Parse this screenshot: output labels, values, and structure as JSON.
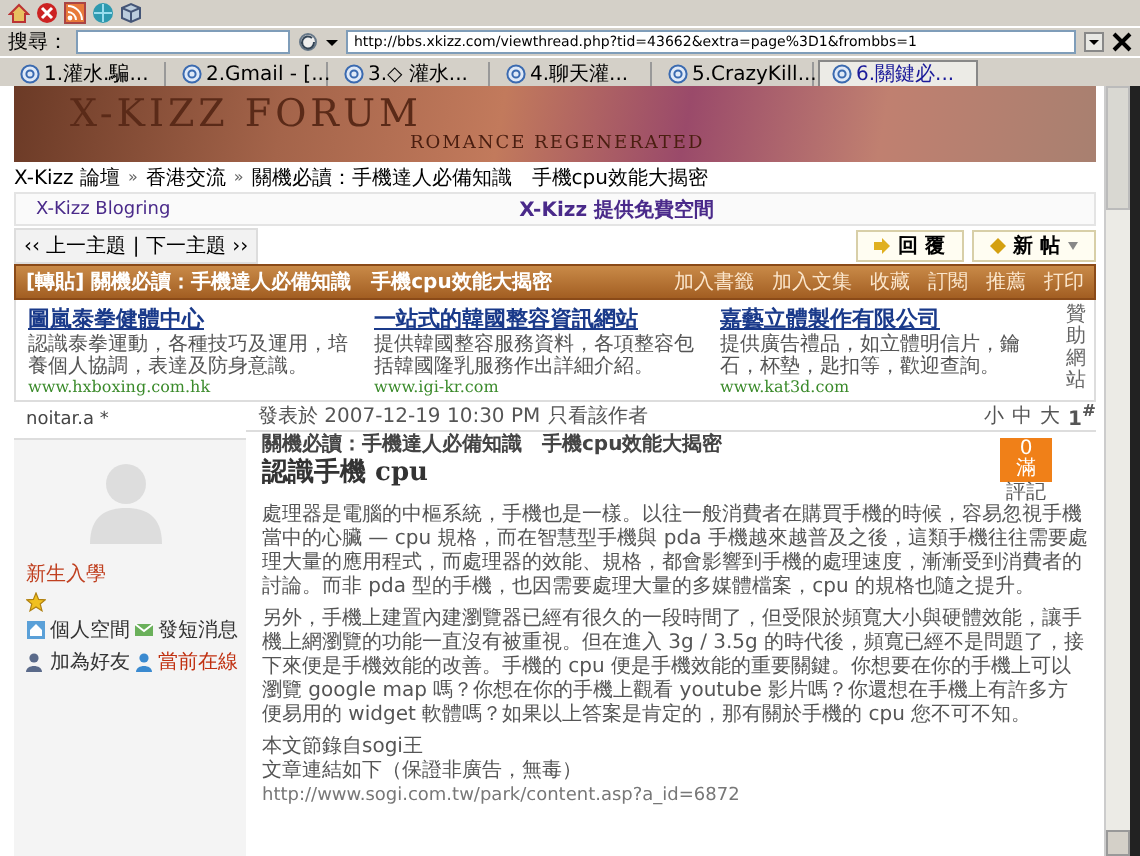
{
  "browser": {
    "search_label": "搜尋：",
    "url": "http://bbs.xkizz.com/viewthread.php?tid=43662&extra=page%3D1&frombbs=1",
    "tabs": [
      {
        "label": "1.灌水.騙...",
        "selected": false
      },
      {
        "label": "2.Gmail - [...",
        "selected": false
      },
      {
        "label": "3.◇ 灌水...",
        "selected": false
      },
      {
        "label": "4.聊天灌...",
        "selected": false
      },
      {
        "label": "5.CrazyKill...",
        "selected": false
      },
      {
        "label": "6.關鍵必...",
        "selected": true
      }
    ]
  },
  "banner": {
    "title": "X-KIZZ FORUM",
    "subtitle": "ROMANCE REGENERATED"
  },
  "breadcrumb": [
    "X-Kizz 論壇",
    "»",
    "香港交流",
    "»",
    "關機必讀：手機達人必備知識　手機cpu效能大揭密"
  ],
  "blogring": [
    "X-Kizz Blogring",
    "X-Kizz 提供免費空間"
  ],
  "thread_nav": {
    "label": "‹‹ 上一主題 | 下一主題 ››",
    "buttons": [
      "回 覆",
      "新 帖"
    ]
  },
  "thread_header": {
    "title": "[轉貼] 關機必讀：手機達人必備知識　手機cpu效能大揭密",
    "actions": [
      "加入書籤",
      "加入文集",
      "收藏",
      "訂閱",
      "推薦",
      "打印"
    ]
  },
  "ads": {
    "items": [
      {
        "title": "圖嵐泰拳健體中心",
        "description": "認識泰拳運動，各種技巧及運用，培養個人協調，表達及防身意識。",
        "url": "www.hxboxing.com.hk"
      },
      {
        "title": "一站式的韓國整容資訊網站",
        "description": "提供韓國整容服務資料，各項整容包括韓國隆乳服務作出詳細介紹。",
        "url": "www.igi-kr.com"
      },
      {
        "title": "嘉藝立體製作有限公司",
        "description": "提供廣告禮品，如立體明信片，鑰石，杯墊，匙扣等，歡迎查詢。",
        "url": "www.kat3d.com"
      }
    ],
    "side_label": "贊助網站"
  },
  "post": {
    "author": "noitar.a *",
    "rank": "新生入學",
    "author_links": [
      "個人空間",
      "發短消息",
      "加為好友",
      "當前在線"
    ],
    "posted": "發表於 2007-12-19 10:30 PM",
    "author_only": "只看該作者",
    "font_sizes": [
      "小",
      "中",
      "大"
    ],
    "floor": "1$^{#}$",
    "subject": "關機必讀：手機達人必備知識　手機cpu效能大揭密",
    "heading": "認識手機 cpu",
    "rating": {
      "count": "0",
      "label": "滿",
      "caption": "評記"
    },
    "paragraphs": [
      "處理器是電腦的中樞系統，手機也是一樣。以往一般消費者在購買手機的時候，容易忽視手機當中的心臟 — cpu 規格，而在智慧型手機與 pda 手機越來越普及之後，這類手機往往需要處理大量的應用程式，而處理器的效能、規格，都會影響到手機的處理速度，漸漸受到消費者的討論。而非 pda 型的手機，也因需要處理大量的多媒體檔案，cpu 的規格也隨之提升。",
      "另外，手機上建置內建瀏覽器已經有很久的一段時間了，但受限於頻寬大小與硬體效能，讓手機上網瀏覽的功能一直沒有被重視。但在進入 3g / 3.5g 的時代後，頻寬已經不是問題了，接下來便是手機效能的改善。手機的 cpu 便是手機效能的重要關鍵。你想要在你的手機上可以瀏覽 google map 嗎？你想在你的手機上觀看 youtube 影片嗎？你還想在手機上有許多方便易用的 widget 軟體嗎？如果以上答案是肯定的，那有關於手機的 cpu 您不可不知。"
    ],
    "source_lines": [
      "本文節錄自sogi王",
      "文章連結如下（保證非廣告，無毒）"
    ],
    "source_link": "http://www.sogi.com.tw/park/content.asp?a_id=6872"
  }
}
